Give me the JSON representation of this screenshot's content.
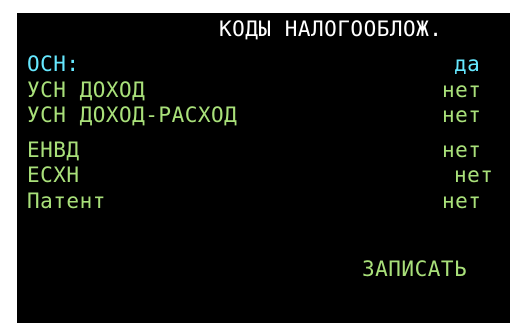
{
  "title": "КОДЫ НАЛОГООБЛОЖ.",
  "tax_codes": [
    {
      "label": "ОСН:",
      "value": "да",
      "selected": true
    },
    {
      "label": "УСН ДОХОД",
      "value": "нет",
      "selected": false
    },
    {
      "label": "УСН ДОХОД-РАСХОД",
      "value": "нет",
      "selected": false
    },
    {
      "label": "ЕНВД",
      "value": "нет",
      "selected": false
    },
    {
      "label": "ЕСХН",
      "value": "нет",
      "selected": false
    },
    {
      "label": "Патент",
      "value": "нет",
      "selected": false
    }
  ],
  "save_label": "ЗАПИСАТЬ",
  "colors": {
    "background": "#000000",
    "title": "#ffffff",
    "selected": "#66e8ff",
    "normal": "#a9e07a"
  }
}
